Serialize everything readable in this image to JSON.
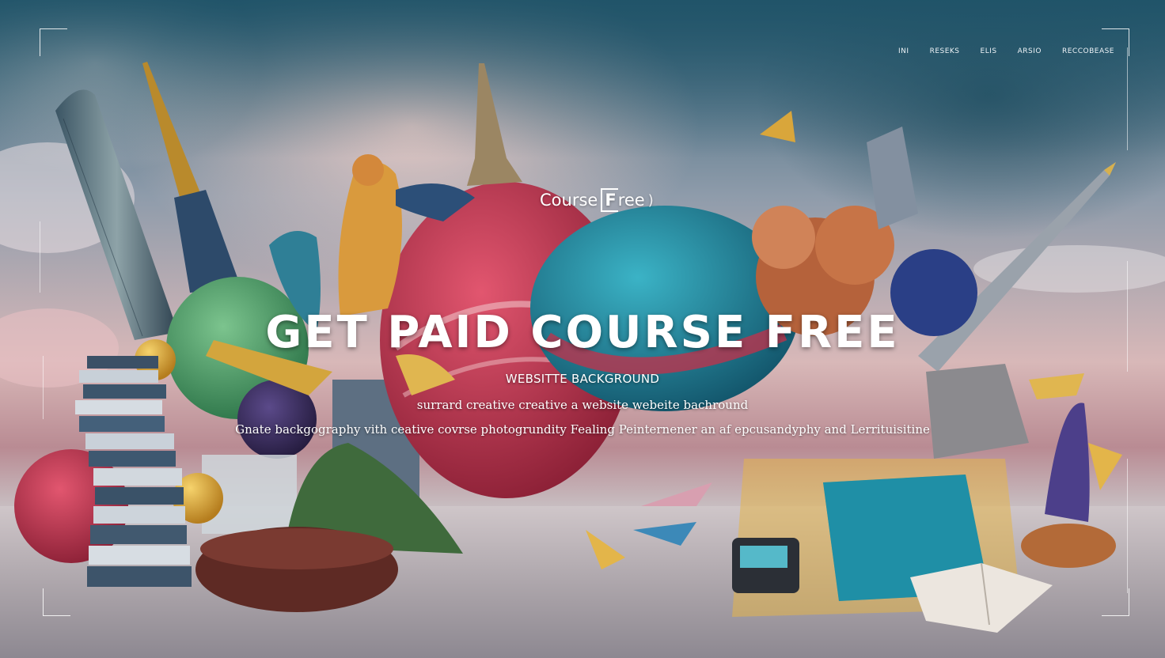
{
  "nav": {
    "items": [
      "INI",
      "RESEKS",
      "ELIS",
      "ARSIO",
      "RECCOBEASE"
    ]
  },
  "logo": {
    "prefix": "Course",
    "mark": "F",
    "rest": "ree",
    "suffix": ")"
  },
  "hero": {
    "headline": "GET PAID COURSE FREE",
    "subheadline": "WEBSITTE BACKGROUND",
    "tagline": "surrard creative creative a website webeite bachround",
    "description": "Gnate backgography vith ceative covrse photogrundity Fealing Peinternener an af epcusandyphy and Lerrituisitine"
  },
  "colors": {
    "sky_top": "#2f5d72",
    "haze": "#d8b8b8",
    "ground": "#a7a0a6",
    "accent_red": "#c5304a",
    "accent_teal": "#1f8fa6",
    "accent_gold": "#e3b54a"
  }
}
